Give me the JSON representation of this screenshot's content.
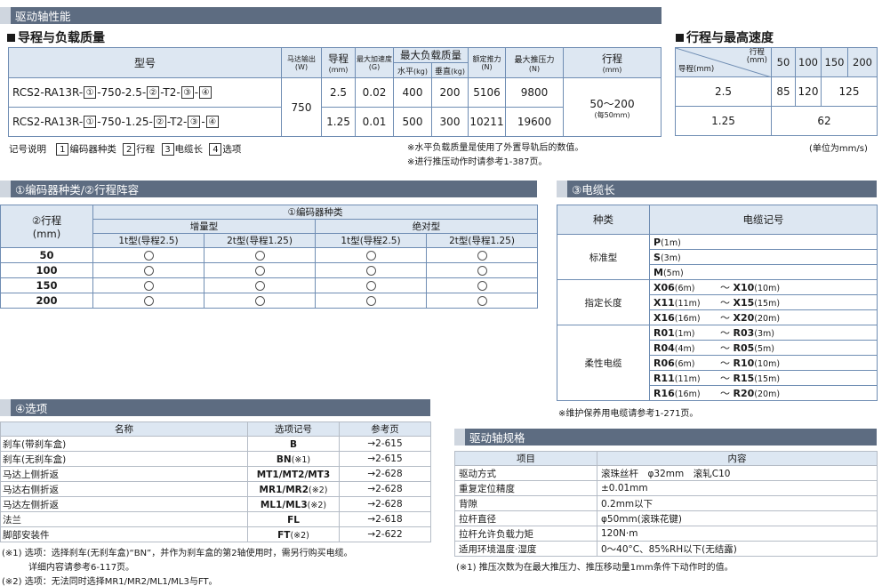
{
  "header_bar": "驱动轴性能",
  "s1": {
    "title": "导程与负载质量",
    "headers": {
      "model": "型号",
      "motor": "马达输出",
      "motor_unit": "(W)",
      "lead": "导程",
      "lead_unit": "(mm)",
      "accel": "最大加速度",
      "accel_unit": "(G)",
      "maxload": "最大负载质量",
      "horiz": "水平",
      "horiz_unit": "(kg)",
      "vert": "垂直",
      "vert_unit": "(kg)",
      "rated": "额定推力",
      "rated_unit": "(N)",
      "maxpush": "最大推压力",
      "maxpush_unit": "(N)",
      "stroke": "行程",
      "stroke_unit": "(mm)"
    },
    "rows": [
      {
        "model_a": "RCS2-RA13R-",
        "m1": "①",
        "model_b": "-750-2.5-",
        "m2": "②",
        "model_c": "-T2-",
        "m3": "③",
        "dash": "-",
        "m4": "④",
        "lead": "2.5",
        "accel": "0.02",
        "horiz": "400",
        "vert": "200",
        "rated": "5106",
        "maxpush": "9800"
      },
      {
        "model_a": "RCS2-RA13R-",
        "m1": "①",
        "model_b": "-750-1.25-",
        "m2": "②",
        "model_c": "-T2-",
        "m3": "③",
        "dash": "-",
        "m4": "④",
        "lead": "1.25",
        "accel": "0.01",
        "horiz": "500",
        "vert": "300",
        "rated": "10211",
        "maxpush": "19600"
      }
    ],
    "motor_value": "750",
    "stroke_value": "50～200",
    "stroke_note": "(每50mm)",
    "legend_label": "记号说明",
    "legend": [
      {
        "num": "1",
        "text": "编码器种类"
      },
      {
        "num": "2",
        "text": "行程"
      },
      {
        "num": "3",
        "text": "电缆长"
      },
      {
        "num": "4",
        "text": "选项"
      }
    ],
    "notes": [
      "※水平负载质量是使用了外置导轨后的数值。",
      "※进行推压动作时请参考1-387页。"
    ]
  },
  "s2": {
    "title": "行程与最高速度",
    "corner_top": "行程",
    "corner_top_unit": "(mm)",
    "corner_bottom": "导程",
    "corner_bottom_unit": "(mm)",
    "strokes": [
      "50",
      "100",
      "150",
      "200"
    ],
    "rows": [
      {
        "lead": "2.5",
        "v50": "85",
        "v100": "120",
        "v150_200": "125"
      },
      {
        "lead": "1.25",
        "all": "62"
      }
    ],
    "unit_note": "(单位为mm/s)"
  },
  "s3": {
    "title": "①编码器种类/②行程阵容",
    "stroke_header": "②行程",
    "stroke_unit": "(mm)",
    "encoder_header": "①编码器种类",
    "incremental": "增量型",
    "absolute": "绝对型",
    "cols": [
      "1t型(导程2.5)",
      "2t型(导程1.25)",
      "1t型(导程2.5)",
      "2t型(导程1.25)"
    ],
    "strokes": [
      "50",
      "100",
      "150",
      "200"
    ]
  },
  "s4": {
    "title": "③电缆长",
    "h_type": "种类",
    "h_code": "电缆记号",
    "groups": [
      {
        "name": "标准型",
        "items": [
          {
            "a": "P",
            "al": "(1m)"
          },
          {
            "a": "S",
            "al": "(3m)"
          },
          {
            "a": "M",
            "al": "(5m)"
          }
        ]
      },
      {
        "name": "指定长度",
        "items": [
          {
            "a": "X06",
            "al": "(6m)",
            "b": "X10",
            "bl": "(10m)"
          },
          {
            "a": "X11",
            "al": "(11m)",
            "b": "X15",
            "bl": "(15m)"
          },
          {
            "a": "X16",
            "al": "(16m)",
            "b": "X20",
            "bl": "(20m)"
          }
        ]
      },
      {
        "name": "柔性电缆",
        "items": [
          {
            "a": "R01",
            "al": "(1m)",
            "b": "R03",
            "bl": "(3m)"
          },
          {
            "a": "R04",
            "al": "(4m)",
            "b": "R05",
            "bl": "(5m)"
          },
          {
            "a": "R06",
            "al": "(6m)",
            "b": "R10",
            "bl": "(10m)"
          },
          {
            "a": "R11",
            "al": "(11m)",
            "b": "R15",
            "bl": "(15m)"
          },
          {
            "a": "R16",
            "al": "(16m)",
            "b": "R20",
            "bl": "(20m)"
          }
        ]
      }
    ],
    "tilde": "～",
    "note": "※维护保养用电缆请参考1-271页。"
  },
  "s5": {
    "title": "④选项",
    "headers": [
      "名称",
      "选项记号",
      "参考页"
    ],
    "rows": [
      {
        "name": "刹车(带刹车盒)",
        "code": "B",
        "suffix": "",
        "page": "→2-615"
      },
      {
        "name": "刹车(无刹车盒)",
        "code": "BN",
        "suffix": "(※1)",
        "page": "→2-615"
      },
      {
        "name": "马达上侧折返",
        "code": "MT1/MT2/MT3",
        "suffix": "",
        "page": "→2-628"
      },
      {
        "name": "马达右侧折返",
        "code": "MR1/MR2",
        "suffix": "(※2)",
        "page": "→2-628"
      },
      {
        "name": "马达左侧折返",
        "code": "ML1/ML3",
        "suffix": "(※2)",
        "page": "→2-628"
      },
      {
        "name": "法兰",
        "code": "FL",
        "suffix": "",
        "page": "→2-618"
      },
      {
        "name": "脚部安装件",
        "code": "FT",
        "suffix": "(※2)",
        "page": "→2-622"
      }
    ],
    "notes": [
      "(※1) 选项：选择刹车(无刹车盒)“BN”，并作为刹车盒的第2轴使用时，需另行购买电缆。",
      "详细内容请参考6-117页。",
      "(※2) 选项：无法同时选择MR1/MR2/ML1/ML3与FT。"
    ]
  },
  "s6": {
    "title": "驱动轴规格",
    "headers": [
      "项目",
      "内容"
    ],
    "rows": [
      {
        "item": "驱动方式",
        "content": "滚珠丝杆　φ32mm　滚轧C10"
      },
      {
        "item": "重复定位精度",
        "content": "±0.01mm"
      },
      {
        "item": "背隙",
        "content": "0.2mm以下"
      },
      {
        "item": "拉杆直径",
        "content": "φ50mm(滚珠花键)"
      },
      {
        "item": "拉杆允许负载力矩",
        "content": "120N·m"
      },
      {
        "item": "适用环境温度·湿度",
        "content": "0～40°C、85%RH以下(无结露)"
      }
    ],
    "note": "(※1) 推压次数为在最大推压力、推压移动量1mm条件下动作时的值。"
  }
}
